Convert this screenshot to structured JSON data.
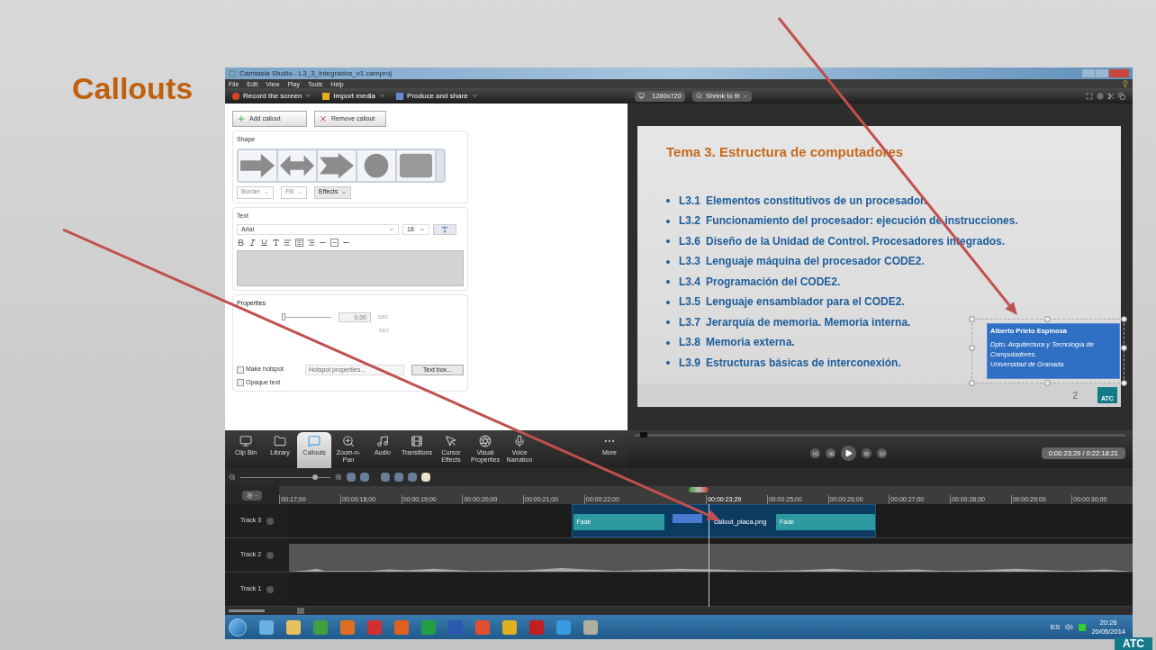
{
  "slide": {
    "title": "Callouts",
    "logo": "ATC"
  },
  "window": {
    "title": "Camtasia Studio - L3_3_integrados_v1.camproj",
    "menu": [
      "File",
      "Edit",
      "View",
      "Play",
      "Tools",
      "Help"
    ],
    "toolbar": [
      "Record the screen",
      "Import media",
      "Produce and share"
    ]
  },
  "callout_panel": {
    "add_button": "Add callout",
    "remove_button": "Remove callout",
    "shape_label": "Shape",
    "shape_buttons": [
      "Border",
      "Fill",
      "Effects"
    ],
    "text_label": "Text",
    "font": "Arial",
    "size": "18",
    "properties_label": "Properties",
    "fade_slider": {
      "level": 0
    },
    "fade_value": "0,00",
    "units": [
      "sec",
      "sec"
    ],
    "checkboxes": [
      {
        "label": "Make hotspot",
        "checked": false
      },
      {
        "label": "Opaque text",
        "checked": false
      }
    ],
    "buttons": [
      {
        "label": "Hotspot properties...",
        "disabled": true
      },
      {
        "label": "Text box...",
        "disabled": false
      }
    ]
  },
  "preview": {
    "size": "1280x720",
    "zoom": "Shrink to fit",
    "slide_title": "Tema 3. Estructura de computadores",
    "bullets": [
      {
        "code": "L3.1",
        "text": "Elementos constitutivos de un procesador."
      },
      {
        "code": "L3.2",
        "text": "Funcionamiento del procesador: ejecución de instrucciones."
      },
      {
        "code": "L3.6",
        "text": "Diseño de la Unidad de Control. Procesadores integrados."
      },
      {
        "code": "L3.3",
        "text": "Lenguaje máquina del  procesador CODE2."
      },
      {
        "code": "L3.4",
        "text": "Programación del CODE2."
      },
      {
        "code": "L3.5",
        "text": "Lenguaje ensamblador para el CODE2."
      },
      {
        "code": "L3.7",
        "text": "Jerarquía de memoria. Memoria interna."
      },
      {
        "code": "L3.8",
        "text": "Memoria externa."
      },
      {
        "code": "L3.9",
        "text": "Estructuras básicas de interconexión."
      }
    ],
    "callout": {
      "name": "Alberto Prieto Espinosa",
      "lines": [
        "Dpto. Arquitectura y Tecnología de Computadores.",
        "Universidad de Granada"
      ]
    },
    "page_number": "2",
    "logo": "ATC"
  },
  "tabs": [
    {
      "label": "Clip Bin",
      "selected": false
    },
    {
      "label": "Library",
      "selected": false
    },
    {
      "label": "Callouts",
      "selected": true
    },
    {
      "label": "Zoom-n-Pan",
      "selected": false
    },
    {
      "label": "Audio",
      "selected": false
    },
    {
      "label": "Transitions",
      "selected": false
    },
    {
      "label": "Cursor Effects",
      "selected": false
    },
    {
      "label": "Visual Properties",
      "selected": false
    },
    {
      "label": "Voice Narration",
      "selected": false
    },
    {
      "label": "More",
      "selected": false
    }
  ],
  "player": {
    "time": "0:00:23:29 / 0:22:18:21"
  },
  "timeline": {
    "zoom_slider": {
      "level": 0.85
    },
    "ticks": [
      "00:17;00",
      "00:00:18;00",
      "00:00:19;00",
      "00:00:20;00",
      "00:00:21;00",
      "00:00:22;00",
      "00:00:23;29",
      "00:00:25;00",
      "00:00:26;00",
      "00:00:27;00",
      "00:00:28;00",
      "00:00:29;00",
      "00:00:30;00"
    ],
    "tracks": [
      {
        "name": "Track 3",
        "kind": "clips",
        "clips": [
          {
            "kind": "transition",
            "label": "Fade"
          },
          {
            "kind": "image"
          },
          {
            "kind": "media",
            "label": "callout_placa.png"
          },
          {
            "kind": "transition",
            "label": "Fade"
          }
        ]
      },
      {
        "name": "Track 2",
        "kind": "audio"
      },
      {
        "name": "Track 1",
        "kind": "empty"
      }
    ]
  },
  "taskbar": {
    "language": "ES",
    "time": "20:26",
    "date": "20/05/2014"
  }
}
